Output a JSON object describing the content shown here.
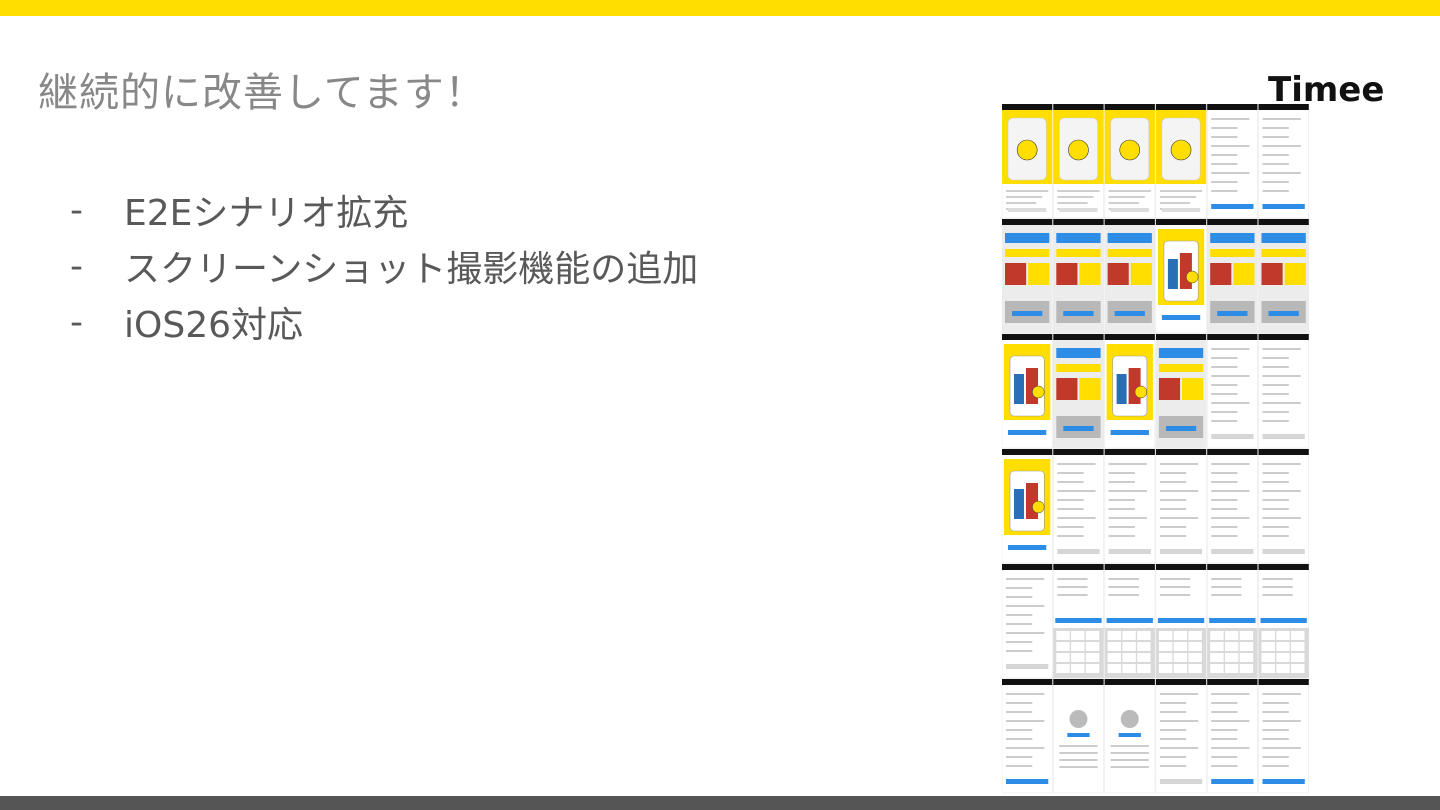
{
  "slide": {
    "title": "継続的に改善してます！",
    "logo_text": "Timee",
    "bullets": [
      {
        "marker": "-",
        "text": "E2Eシナリオ拡充"
      },
      {
        "marker": "-",
        "text": "スクリーンショット撮影機能の追加"
      },
      {
        "marker": "-",
        "text": "iOS26対応"
      }
    ]
  },
  "colors": {
    "brand_yellow": "#FFDE00",
    "footer_gray": "#555555",
    "title_gray": "#888888",
    "text_gray": "#595959",
    "button_blue": "#2D8CE6"
  },
  "screenshot_grid": {
    "rows": [
      [
        "yellow",
        "yellow",
        "yellow",
        "yellow",
        "list",
        "list"
      ],
      [
        "feed",
        "feed",
        "feed",
        "promo",
        "feed",
        "feed"
      ],
      [
        "promo",
        "feed",
        "promo",
        "feed",
        "form",
        "form"
      ],
      [
        "promo",
        "form",
        "form",
        "form",
        "form",
        "form"
      ],
      [
        "form",
        "keypad",
        "keypad",
        "keypad",
        "keypad",
        "keypad"
      ],
      [
        "list",
        "profile",
        "profile",
        "form",
        "list",
        "list"
      ]
    ]
  }
}
